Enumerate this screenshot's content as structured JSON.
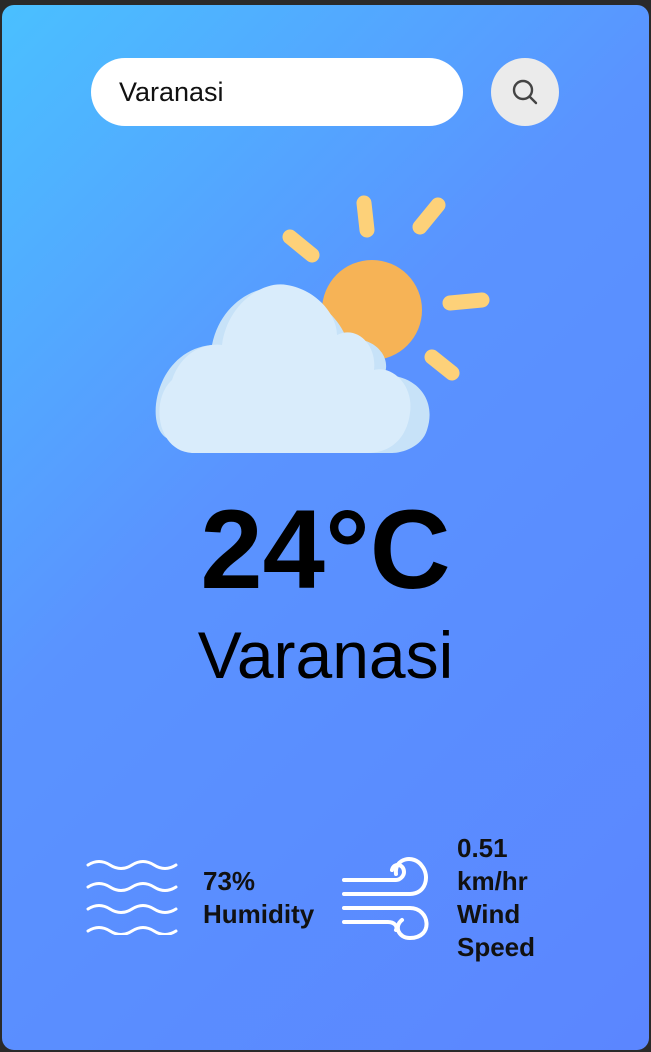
{
  "search": {
    "value": "Varanasi",
    "icon": "search-icon"
  },
  "weather": {
    "icon": "partly-cloudy-icon",
    "temperature": "24°C",
    "city": "Varanasi"
  },
  "humidity": {
    "icon": "humidity-waves-icon",
    "value": "73%",
    "label": "Humidity"
  },
  "wind": {
    "icon": "wind-icon",
    "value": "0.51",
    "unit": "km/hr",
    "label_line1": "Wind",
    "label_line2": "Speed"
  },
  "colors": {
    "gradient_start": "#4ac0ff",
    "gradient_end": "#5b86ff",
    "sun": "#f6b356",
    "sun_rays": "#fdd179",
    "cloud": "#d9ecfb"
  }
}
